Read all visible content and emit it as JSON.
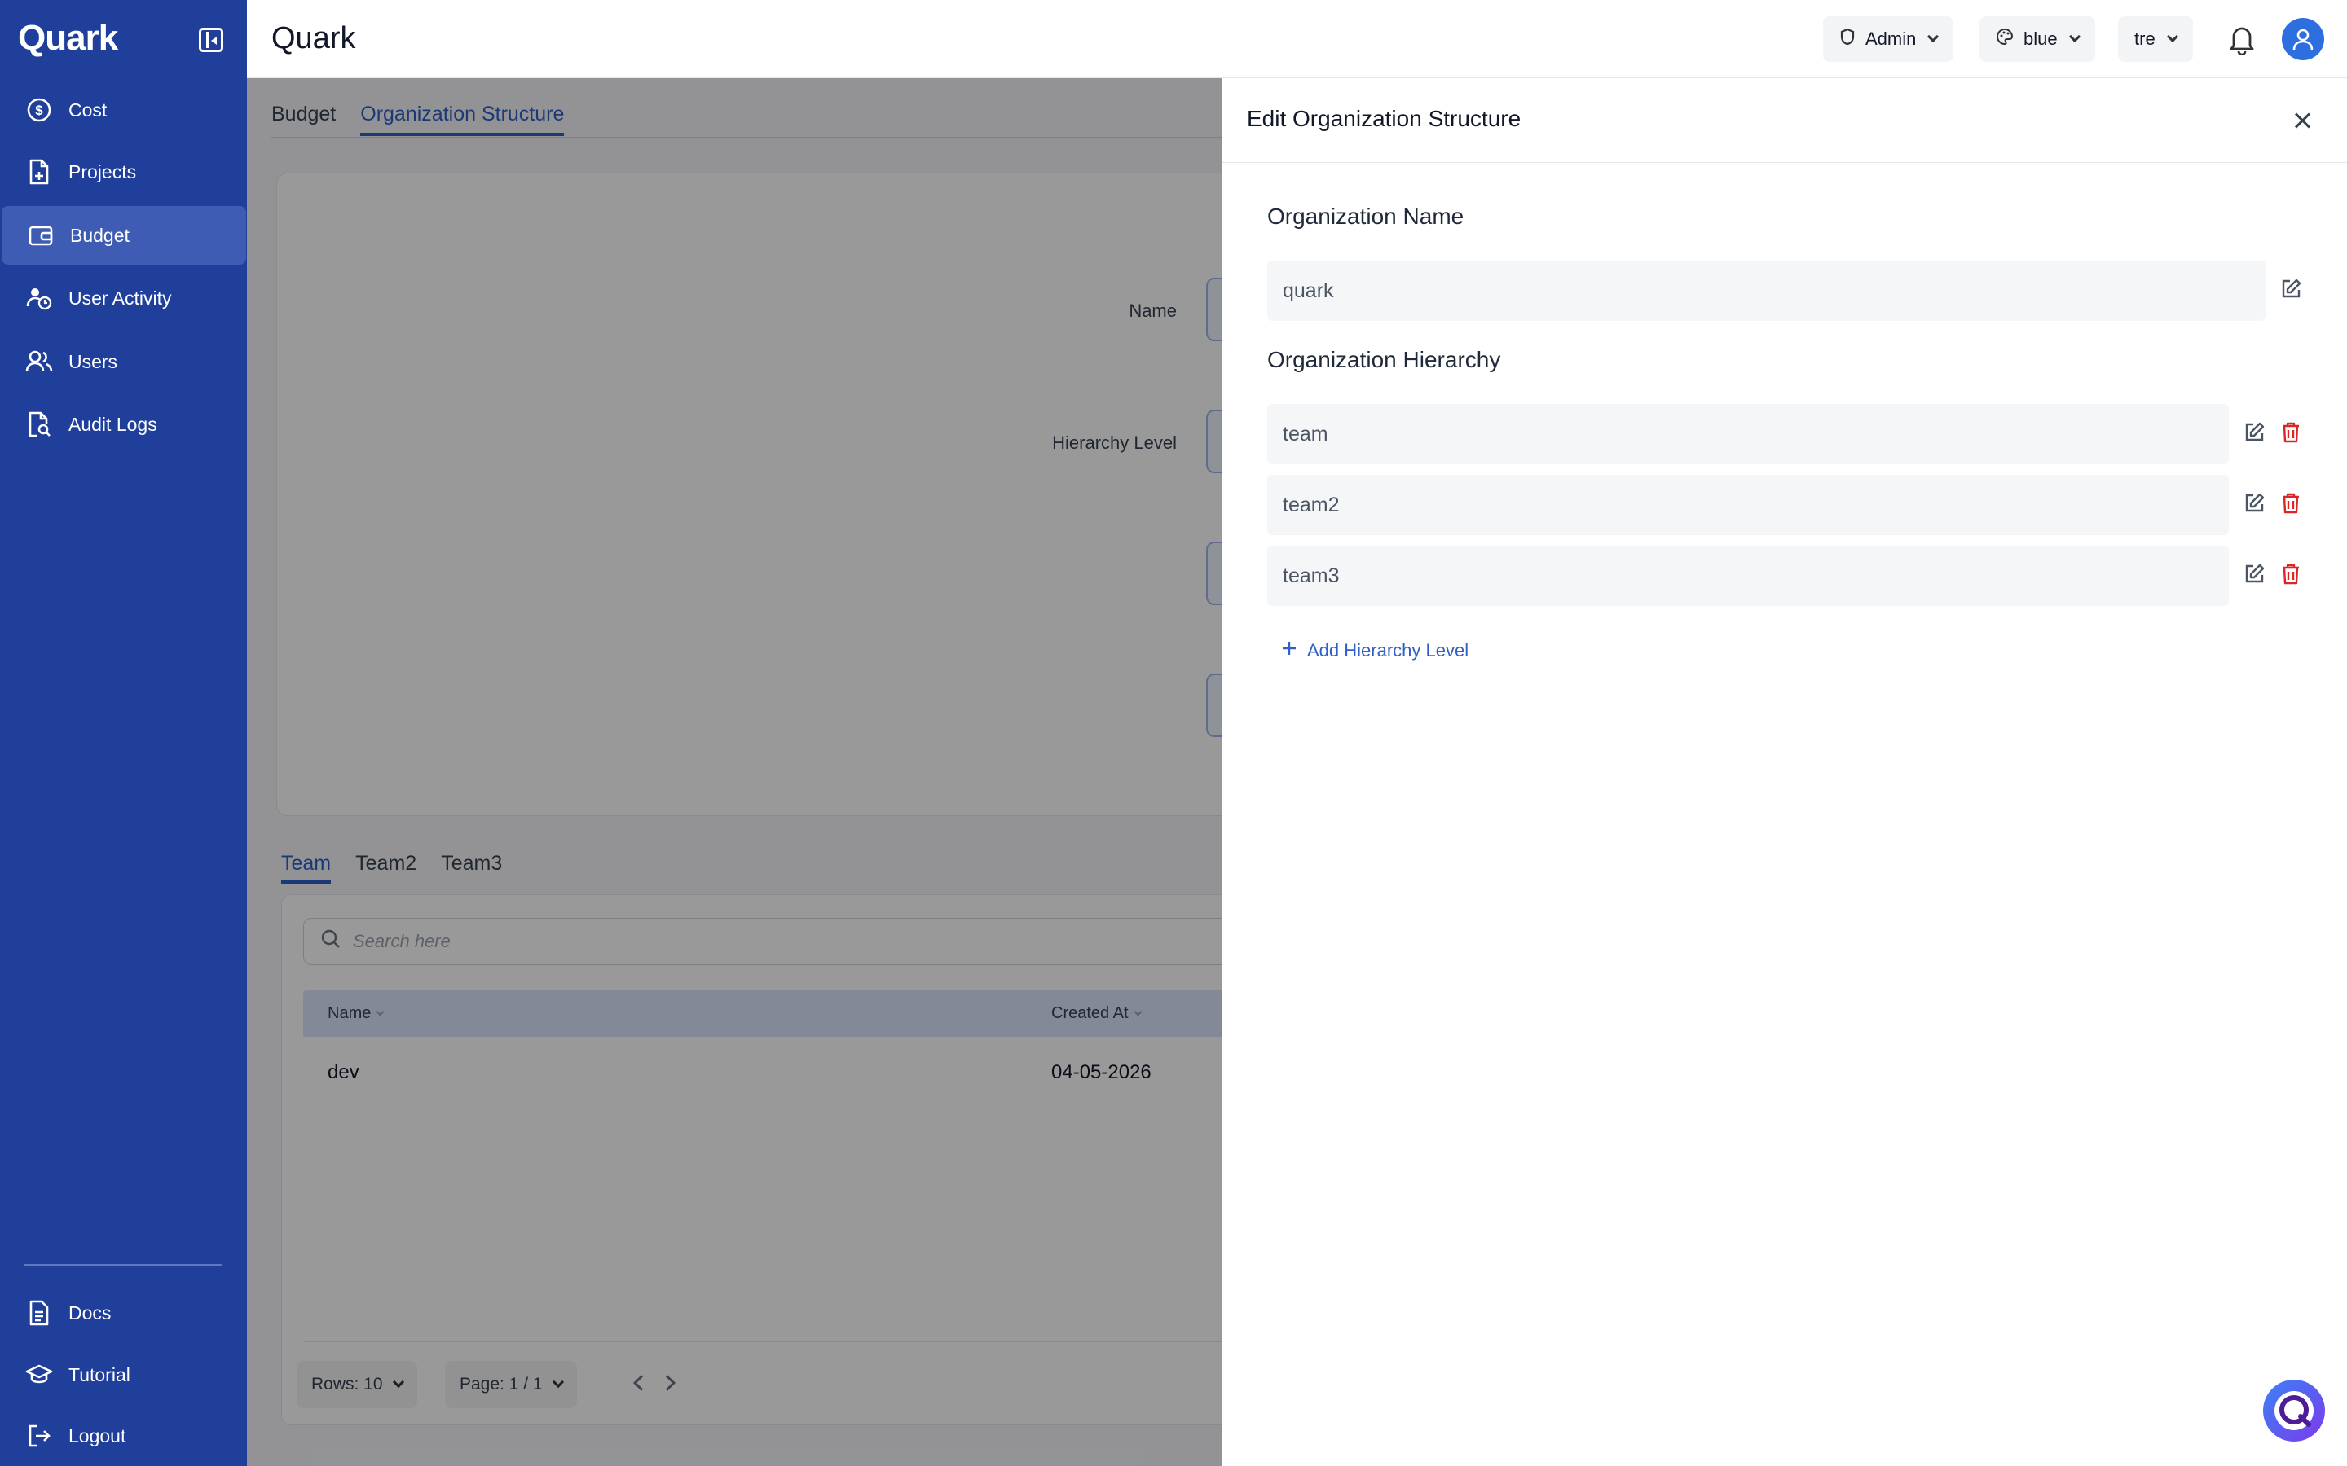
{
  "app": {
    "logo": "Quark",
    "page_title": "Quark"
  },
  "sidebar": {
    "items": [
      {
        "label": "Cost",
        "icon": "dollar-circle-icon"
      },
      {
        "label": "Projects",
        "icon": "file-plus-icon"
      },
      {
        "label": "Budget",
        "icon": "wallet-icon",
        "active": true
      },
      {
        "label": "User Activity",
        "icon": "user-clock-icon"
      },
      {
        "label": "Users",
        "icon": "users-icon"
      },
      {
        "label": "Audit Logs",
        "icon": "file-search-icon"
      }
    ],
    "bottom_items": [
      {
        "label": "Docs",
        "icon": "document-icon"
      },
      {
        "label": "Tutorial",
        "icon": "graduation-cap-icon"
      },
      {
        "label": "Logout",
        "icon": "logout-icon"
      }
    ]
  },
  "header": {
    "role": "Admin",
    "theme": "blue",
    "org": "tre"
  },
  "main": {
    "tabs": [
      "Budget",
      "Organization Structure"
    ],
    "active_tab": "Organization Structure",
    "form": {
      "name_label": "Name",
      "hierarchy_label": "Hierarchy Level"
    },
    "sub_tabs": [
      "Team",
      "Team2",
      "Team3"
    ],
    "search_placeholder": "Search here",
    "table": {
      "columns": [
        "Name",
        "Created At"
      ],
      "rows": [
        {
          "name": "dev",
          "created_at": "04-05-2026"
        }
      ]
    },
    "pagination": {
      "rows": "Rows: 10",
      "page": "Page: 1 / 1"
    }
  },
  "drawer": {
    "title": "Edit Organization Structure",
    "org_name_label": "Organization Name",
    "org_name_value": "quark",
    "hierarchy_label": "Organization Hierarchy",
    "levels": [
      "team",
      "team2",
      "team3"
    ],
    "add_level_label": "Add Hierarchy Level"
  },
  "colors": {
    "sidebar_bg": "#1f3f9b",
    "accent": "#2f5fc7",
    "danger": "#dc2626"
  }
}
